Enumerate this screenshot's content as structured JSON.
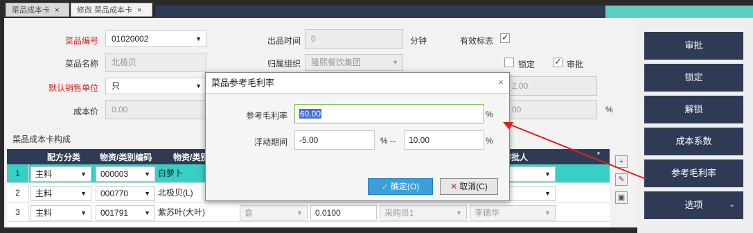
{
  "tabs": [
    {
      "label": "菜品成本卡",
      "close": "×"
    },
    {
      "label": "修改 菜品成本卡",
      "close": "×"
    }
  ],
  "form": {
    "dish_code_label": "菜品编号",
    "dish_code_value": "01020002",
    "output_time_label": "出品时间",
    "output_time_value": "0",
    "output_time_unit": "分钟",
    "valid_flag_label": "有效标志",
    "dish_name_label": "菜品名称",
    "dish_name_value": "北极贝",
    "org_label": "归属组织",
    "org_value": "隆熙餐饮集团",
    "lock_label": "锁定",
    "approve_label": "审批",
    "default_unit_label": "默认销售单位",
    "default_unit_value": "只",
    "price_value": "2.00",
    "cost_price_label": "成本价",
    "cost_price_value": "0.00",
    "gross_value": "00",
    "percent": "%",
    "section_title": "菜品成本卡构成"
  },
  "grid": {
    "headers": [
      "配方分类",
      "物资/类别编码",
      "物资/类别",
      "",
      "",
      "",
      "审批人"
    ],
    "rows": [
      {
        "num": "1",
        "category": "主料",
        "code": "000003",
        "name": "白萝卜",
        "unit": "",
        "qty": "",
        "buyer": "",
        "approver": ""
      },
      {
        "num": "2",
        "category": "主料",
        "code": "000770",
        "name": "北极贝(L)",
        "unit": "",
        "qty": "",
        "buyer": "",
        "approver": ""
      },
      {
        "num": "3",
        "category": "主料",
        "code": "001791",
        "name": "紫苏叶(大叶)",
        "unit": "盒",
        "qty": "0.0100",
        "buyer": "采购员1",
        "approver": "李德华"
      }
    ]
  },
  "right_panel": {
    "buttons": [
      "审批",
      "锁定",
      "解锁",
      "成本系数",
      "参考毛利率",
      "选项"
    ]
  },
  "dialog": {
    "title": "菜品参考毛利率",
    "close": "×",
    "ref_margin_label": "参考毛利率",
    "ref_margin_value": "60.00",
    "ref_margin_unit": "%",
    "float_label": "浮动期间",
    "float_from": "-5.00",
    "float_sep": "% --",
    "float_to": "10.00",
    "float_unit": "%",
    "ok_label": "确定(O)",
    "cancel_label": "取消(C)"
  },
  "colors": {
    "navy": "#2f3b55",
    "teal": "#38cfc4",
    "required_red": "#e0201f",
    "annotation_arrow": "#e02020"
  }
}
